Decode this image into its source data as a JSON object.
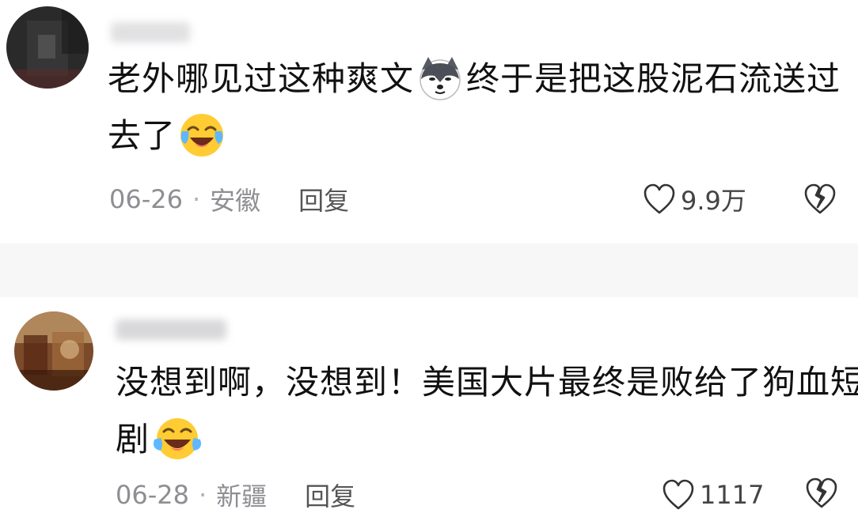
{
  "comments": [
    {
      "text_line1": "老外哪见过这种爽文",
      "text_line1b": "终于是把这股泥石流送过",
      "text_line2": "去了",
      "emoji_1": "husky-dog-icon",
      "emoji_2": "crying-laughing-icon",
      "date": "06-26",
      "location": "安徽",
      "reply_label": "回复",
      "likes": "9.9万"
    },
    {
      "text_line1": "没想到啊，没想到！美国大片最终是败给了狗血短",
      "text_line2": "剧",
      "emoji_1": "crying-laughing-icon",
      "date": "06-28",
      "location": "新疆",
      "reply_label": "回复",
      "likes": "1117"
    }
  ],
  "separator_symbol": "·",
  "colors": {
    "text": "#111111",
    "meta": "#8e8e93",
    "separator_bg": "#f7f7f8",
    "emoji_yellow": "#ffcc33"
  }
}
